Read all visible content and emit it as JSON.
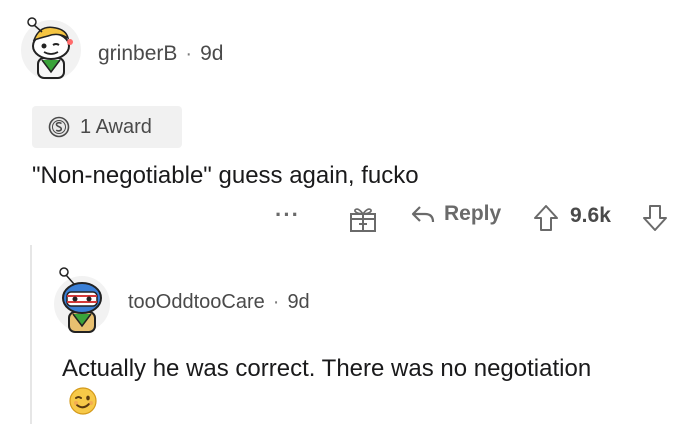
{
  "comment": {
    "username": "grinberB",
    "separator": "·",
    "age": "9d",
    "award": {
      "icon": "silver-award-icon",
      "label": "1 Award"
    },
    "body": "\"Non-negotiable\" guess again, fucko",
    "actions": {
      "more_label": "···",
      "gift_icon": "gift-icon",
      "reply_label": "Reply",
      "score": "9.6k"
    }
  },
  "reply": {
    "username": "tooOddtooCare",
    "separator": "·",
    "age": "9d",
    "body": "Actually he was correct. There was no negotiation",
    "emoji": "winking-face-emoji"
  },
  "colors": {
    "text": "#1a1a1b",
    "meta": "#4a4a4a",
    "chip_bg": "#f1f1f1",
    "thread_line": "#e6e6e6"
  }
}
